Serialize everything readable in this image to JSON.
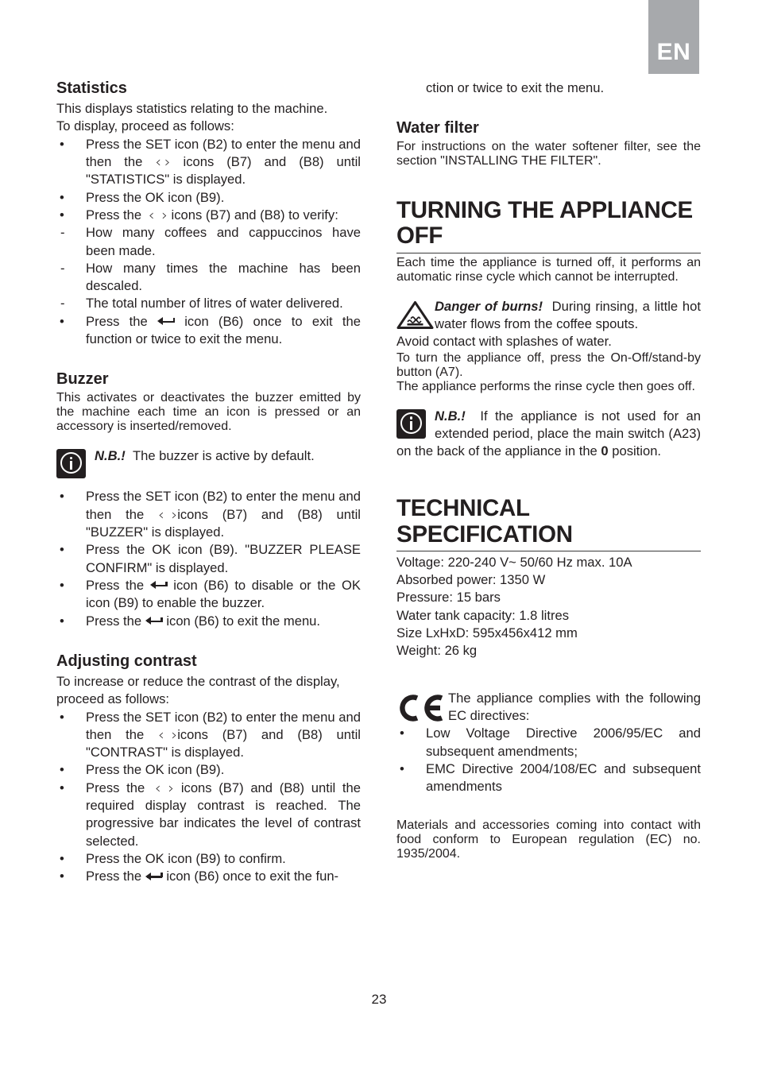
{
  "language_tab": "EN",
  "page_number": "23",
  "icons": {
    "back_arrow": "back-arrow-icon",
    "chevron_left": "‹",
    "chevron_right": "›",
    "info": "info-icon",
    "hot_surface_warning": "hot-surface-warning-icon",
    "ce_mark": "ce-mark-icon"
  },
  "left_column": {
    "statistics": {
      "heading": "Statistics",
      "intro_1": "This displays statistics relating to the machine.",
      "intro_2": "To display, proceed as follows:",
      "items": [
        {
          "marker": "•",
          "parts": [
            "Press the SET icon (B2) to enter the menu and then the ",
            " icons (B7) and (B8) until \"STATISTICS\" is displayed."
          ]
        },
        {
          "marker": "•",
          "text": "Press the OK icon (B9)."
        },
        {
          "marker": "•",
          "parts": [
            "Press the  ",
            " icons (B7) and (B8) to verify:"
          ]
        },
        {
          "marker": "-",
          "text": "How many coffees and cappuccinos have been made."
        },
        {
          "marker": "-",
          "text": "How many times the machine has been descaled."
        },
        {
          "marker": "-",
          "text": "The total number of litres of water delivered."
        },
        {
          "marker": "•",
          "parts": [
            "Press the ",
            " icon (B6) once to exit the function or twice to exit the menu."
          ]
        }
      ]
    },
    "buzzer": {
      "heading": "Buzzer",
      "intro": "This activates or deactivates the buzzer emitted by the machine each time an icon is pressed or an accessory is inserted/removed.",
      "note_label": "N.B.!",
      "note_text": "The buzzer is active by default.",
      "items": [
        {
          "marker": "•",
          "parts": [
            "Press the SET icon (B2) to enter the menu and then the ",
            "icons (B7) and (B8) until \"BUZZER\" is displayed."
          ]
        },
        {
          "marker": "•",
          "text": "Press the OK icon (B9). \"BUZZER PLEASE CONFIRM\" is displayed."
        },
        {
          "marker": "•",
          "parts": [
            "Press the ",
            " icon (B6) to disable or the  OK icon (B9) to enable the buzzer."
          ]
        },
        {
          "marker": "•",
          "parts": [
            "Press the ",
            "  icon (B6) to exit the menu."
          ]
        }
      ]
    },
    "contrast": {
      "heading": "Adjusting contrast",
      "intro_1": "To increase or reduce the contrast of the display,",
      "intro_2": "proceed as follows:",
      "items": [
        {
          "marker": "•",
          "parts": [
            "Press the SET icon (B2) to enter the menu and then the ",
            "icons (B7) and (B8) until \"CONTRAST\" is displayed."
          ]
        },
        {
          "marker": "•",
          "text": "Press the OK icon (B9)."
        },
        {
          "marker": "•",
          "parts": [
            "Press the  ",
            "  icons (B7) and (B8) until the required display contrast is reached. The progressive bar indicates the level of contrast selected."
          ]
        },
        {
          "marker": "•",
          "text": "Press the OK icon (B9) to confirm."
        },
        {
          "marker": "•",
          "parts": [
            "Press the ",
            "  icon (B6) once to exit the fun-"
          ]
        }
      ]
    }
  },
  "right_column": {
    "continuation": "ction or twice to exit the menu.",
    "water_filter": {
      "heading": "Water filter",
      "body": "For instructions on the water softener filter, see the section \"INSTALLING THE FILTER\"."
    },
    "turning_off": {
      "heading": "TURNING THE APPLIANCE OFF",
      "body": "Each time the appliance is turned off, it performs an automatic rinse cycle which cannot be interrupted.",
      "danger_label": "Danger of burns!",
      "danger_text": "During rinsing, a little hot water flows from the coffee spouts.",
      "line_2": "Avoid contact with splashes of water.",
      "line_3": "To turn the appliance off, press the On-Off/stand-by button (A7).",
      "line_4": "The appliance performs the rinse cycle then goes off.",
      "note_label": "N.B.!",
      "note_text_1": "If the appliance is not used for an extended period, place the main switch (A23) on the back of the appliance in the ",
      "note_bold": "0",
      "note_text_2": " position."
    },
    "technical": {
      "heading": "TECHNICAL SPECIFICATION",
      "specs": [
        "Voltage: 220-240 V~ 50/60 Hz max. 10A",
        "Absorbed power: 1350 W",
        "Pressure: 15 bars",
        "Water tank capacity: 1.8 litres",
        "Size LxHxD: 595x456x412 mm",
        "Weight: 26 kg"
      ],
      "ce_text": "The appliance complies with the following EC directives:",
      "directives": [
        {
          "marker": "•",
          "text": "Low Voltage Directive 2006/95/EC and subsequent amendments;"
        },
        {
          "marker": "•",
          "text": "EMC Directive 2004/108/EC and subsequent amendments"
        }
      ],
      "materials": "Materials and accessories coming into contact with food conform to European regulation (EC) no. 1935/2004."
    }
  }
}
